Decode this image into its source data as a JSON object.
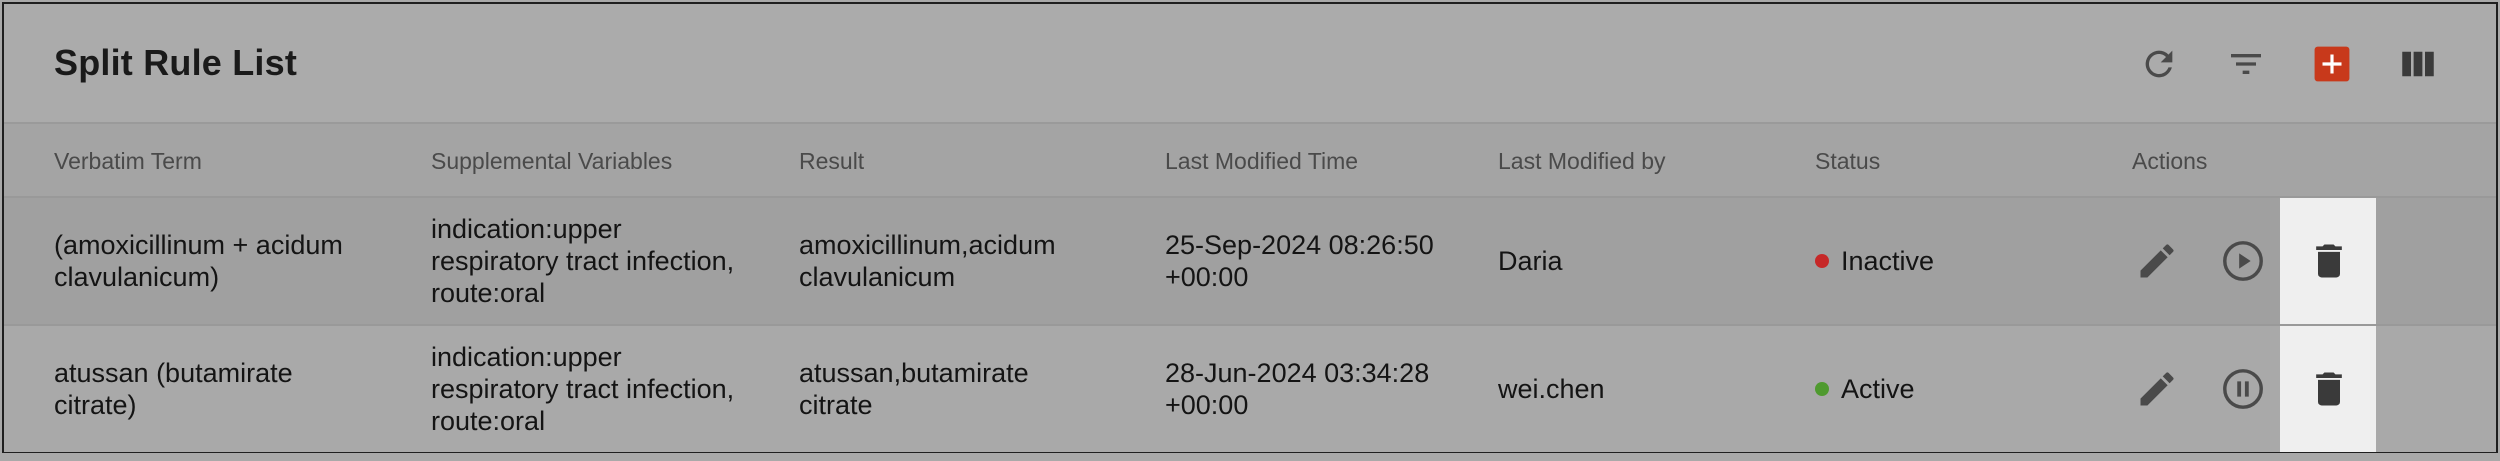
{
  "header": {
    "title": "Split Rule List",
    "actions": [
      {
        "name": "refresh-icon"
      },
      {
        "name": "filter-icon"
      },
      {
        "name": "add-icon",
        "color": "#c8391b"
      },
      {
        "name": "columns-icon"
      }
    ]
  },
  "columns": [
    "Verbatim Term",
    "Supplemental Variables",
    "Result",
    "Last Modified Time",
    "Last Modified by",
    "Status",
    "Actions"
  ],
  "rows": [
    {
      "verbatim": "(amoxicillinum + acidum\nclavulanicum)",
      "supplemental": "indication:upper\nrespiratory tract infection,\nroute:oral",
      "result": "amoxicillinum,acidum\nclavulanicum",
      "modified_time": "25-Sep-2024 08:26:50\n+00:00",
      "modified_by": "Daria",
      "status": "Inactive",
      "status_color": "#c62828",
      "toggle_icon": "play-icon"
    },
    {
      "verbatim": "atussan (butamirate\ncitrate)",
      "supplemental": "indication:upper\nrespiratory tract infection,\nroute:oral",
      "result": "atussan,butamirate\ncitrate",
      "modified_time": "28-Jun-2024 03:34:28\n+00:00",
      "modified_by": "wei.chen",
      "status": "Active",
      "status_color": "#4f9a2f",
      "toggle_icon": "pause-icon"
    }
  ]
}
